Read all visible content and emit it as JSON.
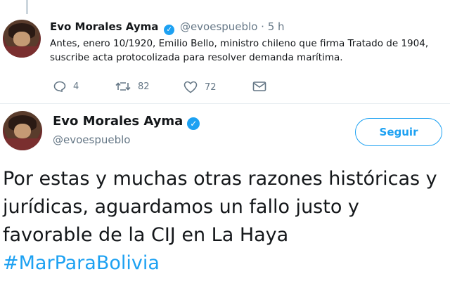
{
  "tweet1": {
    "author_name": "Evo Morales Ayma",
    "handle": "@evoespueblo",
    "separator": "·",
    "time": "5 h",
    "text": "Antes, enero 10/1920, Emilio Bello, ministro chileno que firma Tratado de 1904, suscribe acta protocolizada para resolver demanda marítima.",
    "actions": {
      "reply_icon": "reply-icon",
      "replies": "4",
      "retweet_icon": "retweet-icon",
      "retweets": "82",
      "like_icon": "heart-icon",
      "likes": "72",
      "dm_icon": "envelope-icon"
    }
  },
  "tweet2": {
    "author_name": "Evo Morales Ayma",
    "handle": "@evoespueblo",
    "follow_label": "Seguir",
    "text_lines": [
      "Por estas y muchas otras razones históricas y",
      "jurídicas, aguardamos un fallo justo y",
      "favorable de la CIJ en La Haya"
    ],
    "hashtag": "#MarParaBolivia"
  },
  "colors": {
    "accent": "#1da1f2",
    "muted": "#657786",
    "text": "#14171a",
    "divider": "#e6ecf0"
  }
}
